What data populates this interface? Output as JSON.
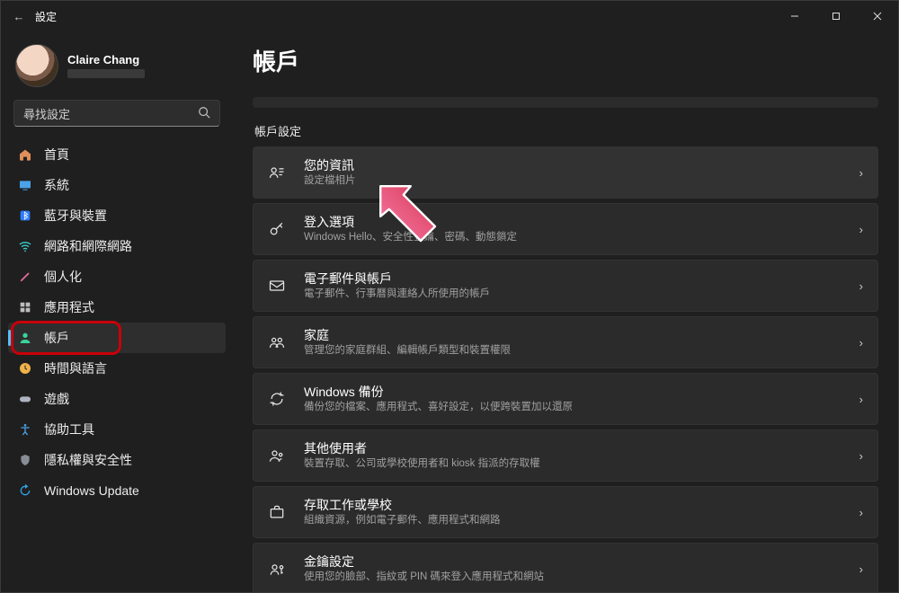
{
  "titlebar": {
    "back": "←",
    "title": "設定"
  },
  "profile": {
    "name": "Claire Chang"
  },
  "search": {
    "placeholder": "尋找設定"
  },
  "nav": [
    {
      "id": "home",
      "label": "首頁",
      "icon": "home",
      "selected": false,
      "color": "#e08f5a"
    },
    {
      "id": "system",
      "label": "系統",
      "icon": "system",
      "selected": false,
      "color": "#4aa3e8"
    },
    {
      "id": "bt",
      "label": "藍牙與裝置",
      "icon": "bt",
      "selected": false,
      "color": "#2f7dff"
    },
    {
      "id": "network",
      "label": "網路和網際網路",
      "icon": "wifi",
      "selected": false,
      "color": "#3ad1d1"
    },
    {
      "id": "personal",
      "label": "個人化",
      "icon": "brush",
      "selected": false,
      "color": "#e06aa0"
    },
    {
      "id": "apps",
      "label": "應用程式",
      "icon": "apps",
      "selected": false,
      "color": "#bdbdbd"
    },
    {
      "id": "accounts",
      "label": "帳戶",
      "icon": "person",
      "selected": true,
      "color": "#39d39a",
      "highlight": true
    },
    {
      "id": "time",
      "label": "時間與語言",
      "icon": "clock",
      "selected": false,
      "color": "#f0b24a"
    },
    {
      "id": "gaming",
      "label": "遊戲",
      "icon": "game",
      "selected": false,
      "color": "#aeb4c0"
    },
    {
      "id": "access",
      "label": "協助工具",
      "icon": "access",
      "selected": false,
      "color": "#4aa3e8"
    },
    {
      "id": "privacy",
      "label": "隱私權與安全性",
      "icon": "shield",
      "selected": false,
      "color": "#888c93"
    },
    {
      "id": "update",
      "label": "Windows Update",
      "icon": "update",
      "selected": false,
      "color": "#2fa2e8"
    }
  ],
  "page": {
    "heading": "帳戶",
    "section": "帳戶設定",
    "cards": [
      {
        "id": "your-info",
        "icon": "id",
        "title": "您的資訊",
        "sub": "設定檔相片",
        "hover": true
      },
      {
        "id": "signin",
        "icon": "key",
        "title": "登入選項",
        "sub": "Windows Hello、安全性金鑰、密碼、動態鎖定"
      },
      {
        "id": "email",
        "icon": "mail",
        "title": "電子郵件與帳戶",
        "sub": "電子郵件、行事曆與連絡人所使用的帳戶"
      },
      {
        "id": "family",
        "icon": "family",
        "title": "家庭",
        "sub": "管理您的家庭群組、編輯帳戶類型和裝置權限"
      },
      {
        "id": "backup",
        "icon": "sync",
        "title": "Windows 備份",
        "sub": "備份您的檔案、應用程式、喜好設定，以便跨裝置加以還原"
      },
      {
        "id": "other-users",
        "icon": "users",
        "title": "其他使用者",
        "sub": "裝置存取、公司或學校使用者和 kiosk 指派的存取權"
      },
      {
        "id": "work-school",
        "icon": "brief",
        "title": "存取工作或學校",
        "sub": "組織資源，例如電子郵件、應用程式和網路"
      },
      {
        "id": "passkeys",
        "icon": "passkey",
        "title": "金鑰設定",
        "sub": "使用您的臉部、指紋或 PIN 碼來登入應用程式和網站"
      }
    ]
  }
}
